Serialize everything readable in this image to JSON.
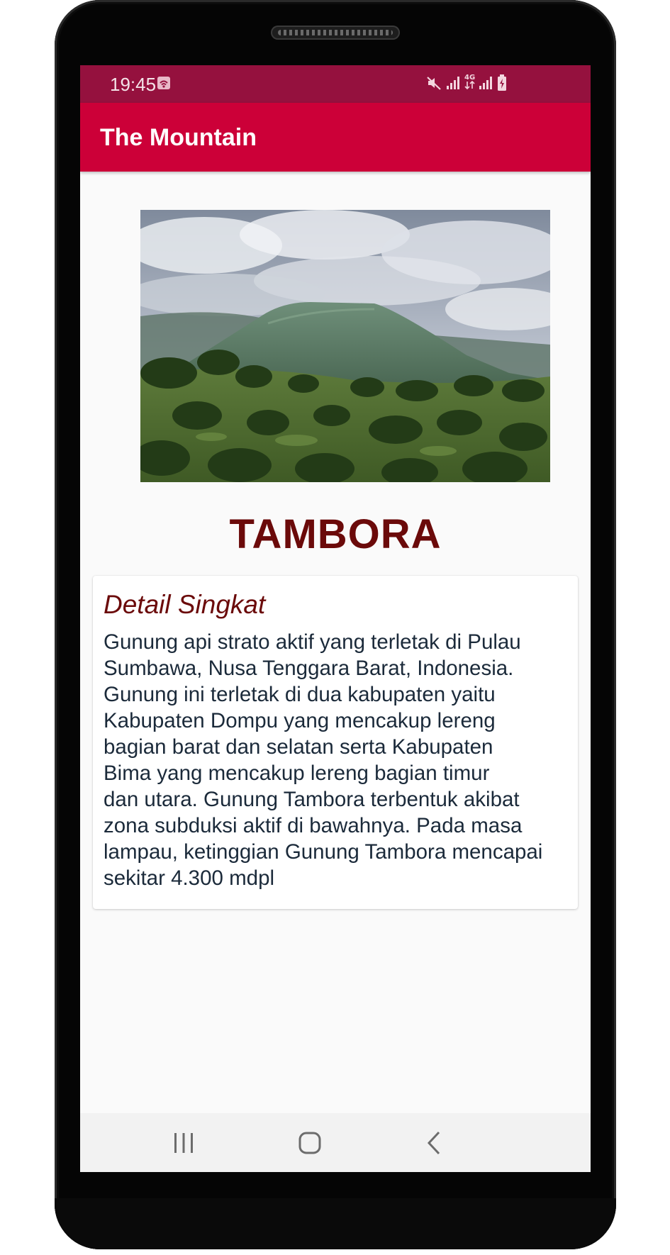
{
  "status_bar": {
    "time": "19:45",
    "icons": [
      "wifi-hotspot-icon",
      "mute-icon",
      "signal-icon",
      "4g-icon",
      "signal-icon",
      "battery-charging-icon"
    ]
  },
  "app_bar": {
    "title": "The Mountain"
  },
  "detail": {
    "image_name": "mountain-photo",
    "name": "TAMBORA",
    "card_title": "Detail Singkat",
    "description_lines": [
      "Gunung api strato aktif yang terletak di Pulau",
      "Sumbawa, Nusa Tenggara Barat, Indonesia.",
      "Gunung ini terletak di dua kabupaten yaitu",
      "Kabupaten Dompu yang mencakup lereng",
      "bagian barat dan selatan serta Kabupaten",
      "Bima yang mencakup lereng bagian timur",
      "dan utara. Gunung Tambora terbentuk akibat",
      "zona subduksi aktif di bawahnya. Pada masa",
      "lampau, ketinggian Gunung Tambora mencapai",
      "sekitar 4.300 mdpl"
    ]
  },
  "nav_bar": {
    "buttons": [
      "recent-apps-icon",
      "home-icon",
      "back-icon"
    ]
  },
  "colors": {
    "status_bar": "#95113e",
    "app_bar": "#cc0038",
    "title_text": "#6b0a0a"
  }
}
